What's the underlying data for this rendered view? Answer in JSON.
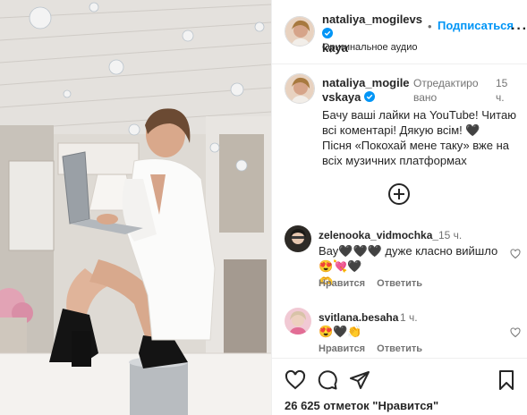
{
  "post": {
    "username_line1": "nataliya_mogilevs",
    "username_line2": "kaya",
    "follow_label": "Подписаться",
    "audio": "Оригинальное аудио",
    "more_label": "···"
  },
  "caption": {
    "username_line1": "nataliya_mogile",
    "username_line2": "vskaya",
    "edited_line1": "Отредактиро",
    "edited_line2": "вано",
    "time_line1": "15",
    "time_line2": "ч.",
    "lines": [
      "Бачу ваші лайки на YouTube! Читаю",
      "всі коментарі! Дякую всім! 🖤",
      "Пісня «Покохай мене таку» вже на",
      "всіх музичних платформах"
    ]
  },
  "comments": [
    {
      "username": "zelenooka_vidmochka_",
      "time": "15 ч.",
      "text_line1": "Вау🖤🖤🖤 дуже класно вийшло 😍💘🖤",
      "text_line2": "🫶",
      "like_label": "Нравится",
      "reply_label": "Ответить"
    },
    {
      "username": "svitlana.besaha",
      "time": "1 ч.",
      "text_line1": "😍🖤👏",
      "like_label": "Нравится",
      "reply_label": "Ответить"
    }
  ],
  "likes": "26 625 отметок \"Нравится\"",
  "icons": [
    "verified-icon",
    "more-icon",
    "load-more-icon",
    "heart-icon",
    "comment-icon",
    "share-icon",
    "bookmark-icon"
  ],
  "colors": {
    "accent": "#0095f6",
    "verified": "#0095f6",
    "text": "#262626",
    "muted": "#737373"
  }
}
